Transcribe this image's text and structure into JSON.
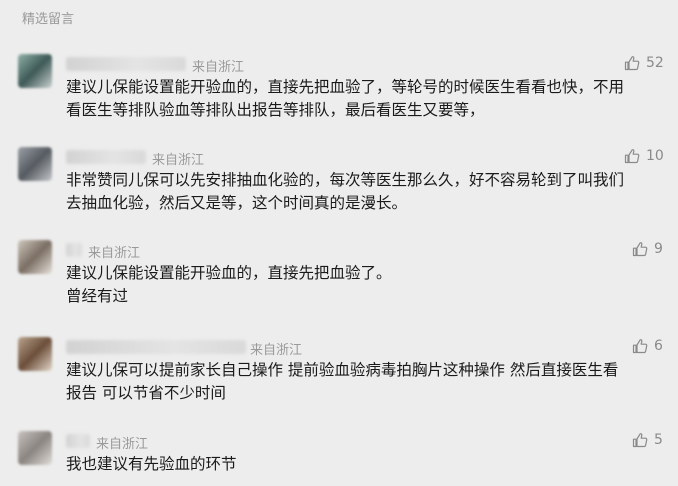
{
  "header": {
    "title": "精选留言"
  },
  "comments": [
    {
      "origin": "来自浙江",
      "likes": "52",
      "lines": [
        "建议儿保能设置能开验血的，直接先把血验了，等轮号的时候医生看看也快，不用",
        "看医生等排队验血等排队出报告等排队，最后看医生又要等，"
      ]
    },
    {
      "origin": "来自浙江",
      "likes": "10",
      "lines": [
        "非常赞同儿保可以先安排抽血化验的，每次等医生那么久，好不容易轮到了叫我们",
        "去抽血化验，然后又是等，这个时间真的是漫长。"
      ]
    },
    {
      "origin": "来自浙江",
      "likes": "9",
      "lines": [
        "建议儿保能设置能开验血的，直接先把血验了。",
        "曾经有过"
      ]
    },
    {
      "origin": "来自浙江",
      "likes": "6",
      "lines": [
        "建议儿保可以提前家长自己操作 提前验血验病毒拍胸片这种操作  然后直接医生看",
        "报告 可以节省不少时间"
      ]
    },
    {
      "origin": "来自浙江",
      "likes": "5",
      "lines": [
        "我也建议有先验血的环节"
      ]
    }
  ],
  "icons": {
    "like": "thumbs-up-icon"
  }
}
